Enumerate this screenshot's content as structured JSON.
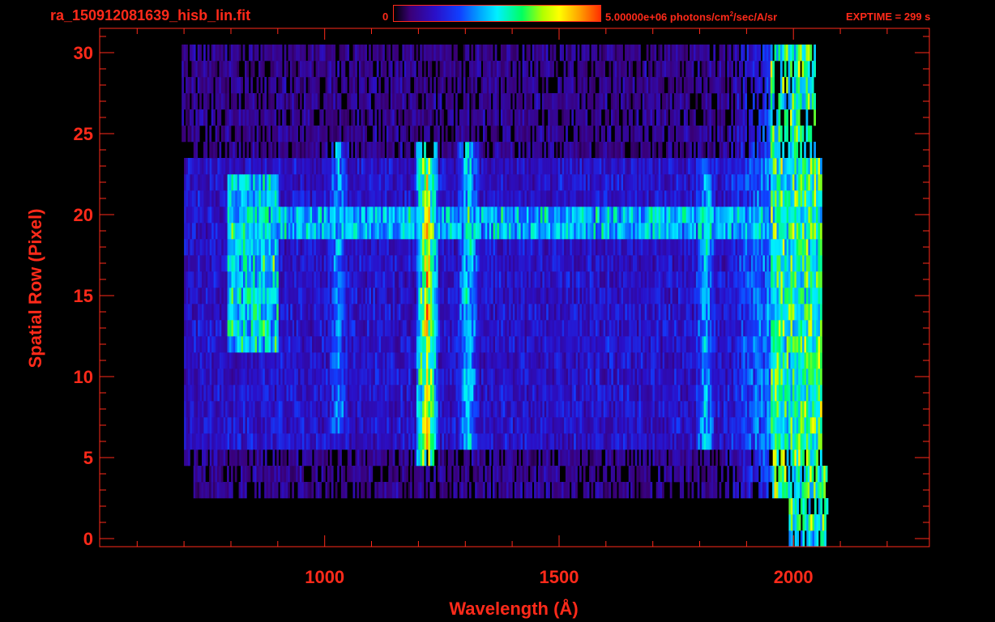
{
  "header": {
    "file_title": "ra_150912081639_hisb_lin.fit",
    "colorbar_min": "0",
    "colorbar_max_value": "5.00000e+06 photons/cm",
    "colorbar_max_exp": "2",
    "colorbar_max_unit": "/sec/A/sr",
    "exptime": "EXPTIME = 299 s"
  },
  "colors": {
    "axis": "#ff2a1a",
    "background": "#000000",
    "colormap": [
      "#000000",
      "#3a0078",
      "#2a10c8",
      "#1040ff",
      "#00a8ff",
      "#00f0ff",
      "#00ff60",
      "#b0ff00",
      "#ffff00",
      "#ffa000",
      "#ff3000"
    ]
  },
  "chart_data": {
    "type": "heatmap",
    "title": "ra_150912081639_hisb_lin.fit",
    "xlabel": "Wavelength (Å)",
    "ylabel": "Spatial Row (Pixel)",
    "xlim": [
      520,
      2290
    ],
    "ylim": [
      -0.5,
      31.5
    ],
    "x_ticks": [
      1000,
      1500,
      2000
    ],
    "y_ticks": [
      0,
      5,
      10,
      15,
      20,
      25,
      30
    ],
    "colorbar_range": [
      0,
      5000000
    ],
    "colorbar_unit": "photons/cm^2/sec/A/sr",
    "exptime_s": 299,
    "features": [
      {
        "name": "bright line",
        "x": 1216,
        "rows": [
          5,
          24
        ],
        "level": 0.8
      },
      {
        "name": "line",
        "x": 1304,
        "rows": [
          6,
          24
        ],
        "level": 0.5
      },
      {
        "name": "line",
        "x": 1027,
        "rows": [
          7,
          24
        ],
        "level": 0.4
      },
      {
        "name": "line",
        "x": 1810,
        "rows": [
          6,
          23
        ],
        "level": 0.45
      },
      {
        "name": "blob",
        "x": [
          790,
          900
        ],
        "rows": [
          12,
          22
        ],
        "level": 0.5
      },
      {
        "name": "horizontal band",
        "x": [
          800,
          2060
        ],
        "rows": [
          19,
          20
        ],
        "level": 0.45
      },
      {
        "name": "long-wavelength edge",
        "x": [
          1950,
          2070
        ],
        "rows": [
          1,
          30
        ],
        "level": 0.6
      }
    ]
  }
}
